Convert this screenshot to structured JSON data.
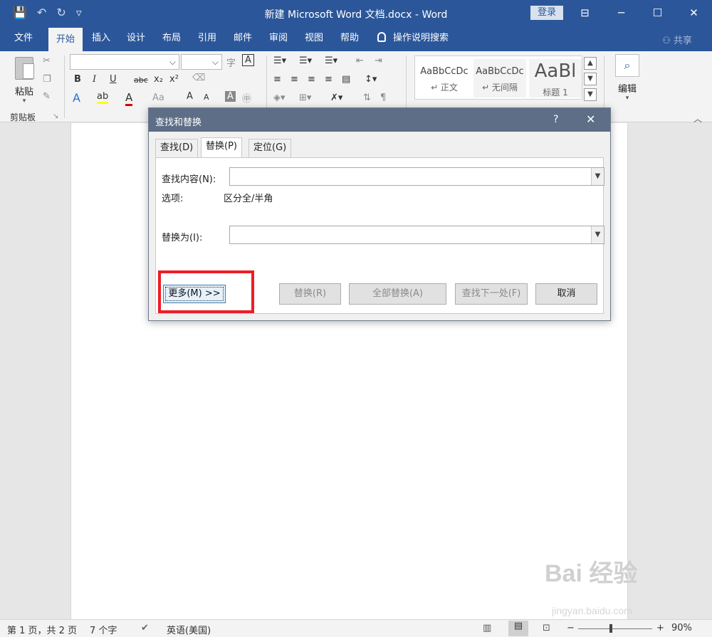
{
  "window": {
    "title": "新建 Microsoft Word 文档.docx  -  Word",
    "login_label": "登录",
    "controls": [
      "⊟",
      "─",
      "☐",
      "✕"
    ]
  },
  "qat": [
    "💾",
    "↶",
    "↻",
    "▿"
  ],
  "ribbon_tabs": [
    "文件",
    "开始",
    "插入",
    "设计",
    "布局",
    "引用",
    "邮件",
    "审阅",
    "视图",
    "帮助"
  ],
  "active_tab": "开始",
  "tell_me": "操作说明搜索",
  "share": "共享",
  "clipboard": {
    "paste_label": "粘贴",
    "group_label": "剪贴板",
    "launcher": "↘"
  },
  "font": {
    "buttons": [
      "B",
      "I",
      "U",
      "abc",
      "x₂",
      "x²",
      "A",
      "A",
      "Aa",
      "A",
      "A",
      "A",
      "㊥"
    ]
  },
  "styles": [
    {
      "sample": "AaBbCcDc",
      "name": "↵ 正文"
    },
    {
      "sample": "AaBbCcDc",
      "name": "↵ 无间隔"
    },
    {
      "sample": "AaBl",
      "name": "标题 1"
    }
  ],
  "editing": {
    "label": "编辑"
  },
  "dialog": {
    "title": "查找和替换",
    "help": "?",
    "close": "✕",
    "tabs": [
      "查找(D)",
      "替换(P)",
      "定位(G)"
    ],
    "active_tab": "替换(P)",
    "find_label": "查找内容(N):",
    "find_value": "",
    "options_label": "选项:",
    "options_value": "区分全/半角",
    "replace_label": "替换为(I):",
    "replace_value": "",
    "buttons": {
      "more": "更多(M) >>",
      "replace": "替换(R)",
      "replace_all": "全部替换(A)",
      "find_next": "查找下一处(F)",
      "cancel": "取消"
    }
  },
  "statusbar": {
    "page": "第 1 页，共 2 页",
    "words": "7 个字",
    "language": "英语(美国)",
    "zoom": "90%",
    "zoom_minus": "−",
    "zoom_plus": "+"
  },
  "watermark": {
    "main": "Bai 经验",
    "sub": "jingyan.baidu.com"
  }
}
